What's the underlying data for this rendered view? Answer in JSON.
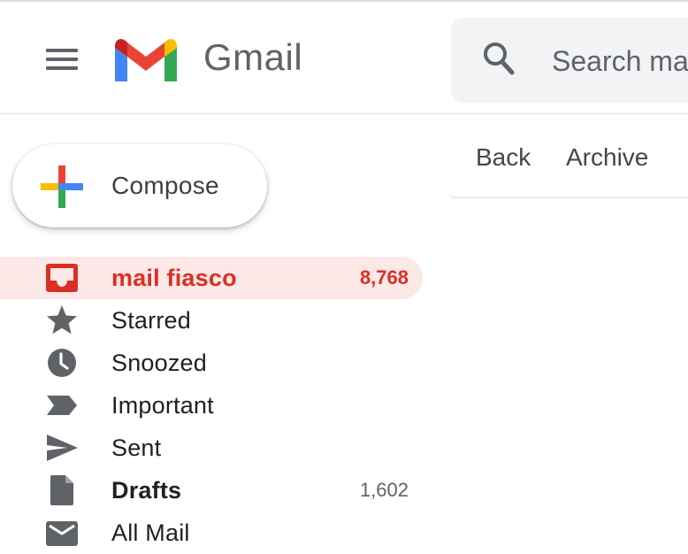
{
  "app": {
    "name": "Gmail"
  },
  "search": {
    "placeholder": "Search mail",
    "icon": "search-icon"
  },
  "toolbar": {
    "back_label": "Back",
    "archive_label": "Archive"
  },
  "compose": {
    "label": "Compose",
    "icon": "plus-icon"
  },
  "sidebar": {
    "items": [
      {
        "label": "mail fiasco",
        "count": "8,768",
        "icon": "inbox-icon",
        "active": true
      },
      {
        "label": "Starred",
        "count": "",
        "icon": "star-icon"
      },
      {
        "label": "Snoozed",
        "count": "",
        "icon": "clock-icon"
      },
      {
        "label": "Important",
        "count": "",
        "icon": "important-icon"
      },
      {
        "label": "Sent",
        "count": "",
        "icon": "send-icon"
      },
      {
        "label": "Drafts",
        "count": "1,602",
        "icon": "draft-icon",
        "bold": true
      },
      {
        "label": "All Mail",
        "count": "",
        "icon": "mail-icon"
      }
    ]
  },
  "colors": {
    "accent_red": "#d93025",
    "active_bg": "#fce8e6",
    "icon_gray": "#5f6368",
    "search_bg": "#f1f3f4"
  }
}
